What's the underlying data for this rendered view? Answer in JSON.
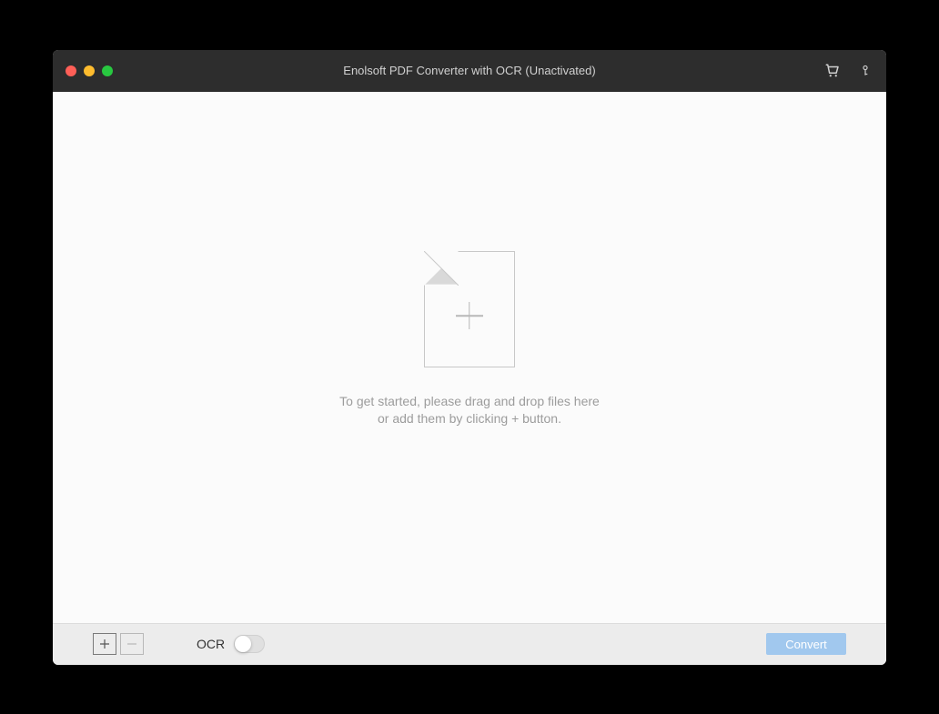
{
  "titlebar": {
    "title": "Enolsoft PDF Converter with OCR (Unactivated)"
  },
  "dropzone": {
    "line1": "To get started, please drag and drop files here",
    "line2": "or add them by clicking + button."
  },
  "footer": {
    "add_label": "+",
    "remove_label": "−",
    "ocr_label": "OCR",
    "convert_label": "Convert"
  }
}
